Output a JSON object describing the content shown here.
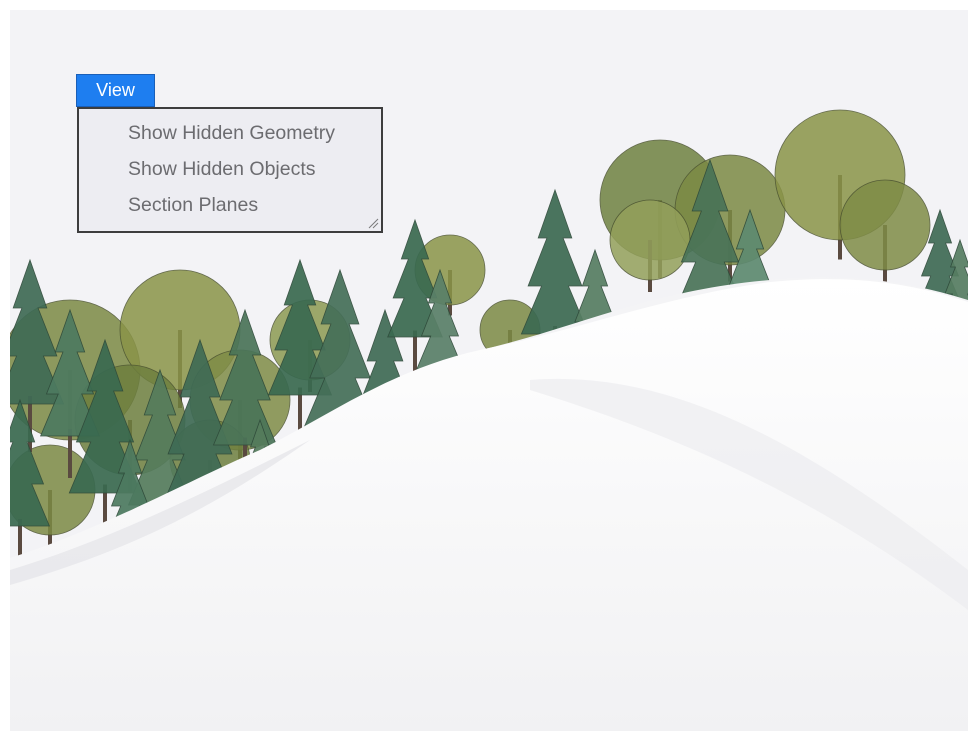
{
  "menu": {
    "button_label": "View",
    "items": [
      {
        "label": "Show Hidden Geometry"
      },
      {
        "label": "Show Hidden Objects"
      },
      {
        "label": "Section Planes"
      }
    ]
  },
  "icons": {
    "resize_grip": "resize-grip-icon"
  },
  "colors": {
    "menu_button": "#1e7ef0",
    "menu_text": "#6c6c70",
    "sky": "#f3f3f6",
    "snow": "#f7f7f8"
  }
}
